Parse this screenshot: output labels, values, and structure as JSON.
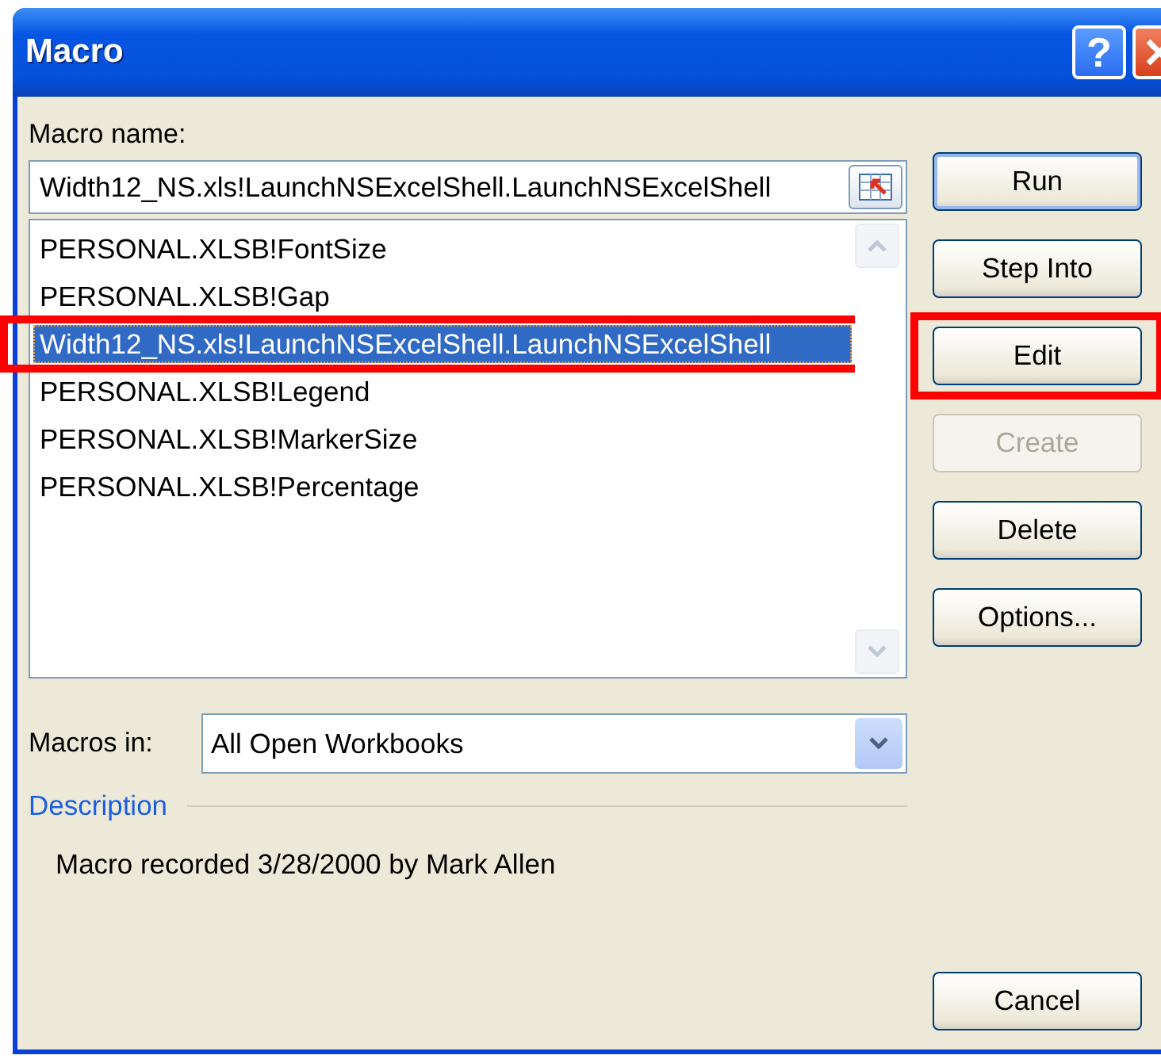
{
  "window": {
    "title": "Macro",
    "help_button": "?"
  },
  "macro_name": {
    "label": "Macro name:",
    "value": "Width12_NS.xls!LaunchNSExcelShell.LaunchNSExcelShell"
  },
  "macro_list": {
    "items": [
      {
        "text": "PERSONAL.XLSB!FontSize",
        "selected": false,
        "highlighted": false
      },
      {
        "text": "PERSONAL.XLSB!Gap",
        "selected": false,
        "highlighted": false
      },
      {
        "text": "Width12_NS.xls!LaunchNSExcelShell.LaunchNSExcelShell",
        "selected": true,
        "highlighted": true
      },
      {
        "text": "PERSONAL.XLSB!Legend",
        "selected": false,
        "highlighted": false
      },
      {
        "text": "PERSONAL.XLSB!MarkerSize",
        "selected": false,
        "highlighted": false
      },
      {
        "text": "PERSONAL.XLSB!Percentage",
        "selected": false,
        "highlighted": false
      }
    ]
  },
  "macros_in": {
    "label": "Macros in:",
    "value": "All Open Workbooks"
  },
  "description": {
    "heading": "Description",
    "text": "Macro recorded 3/28/2000 by Mark Allen"
  },
  "buttons": [
    {
      "label": "Run",
      "default": true,
      "disabled": false,
      "highlighted": false
    },
    {
      "label": "Step Into",
      "default": false,
      "disabled": false,
      "highlighted": false
    },
    {
      "label": "Edit",
      "default": false,
      "disabled": false,
      "highlighted": true
    },
    {
      "label": "Create",
      "default": false,
      "disabled": true,
      "highlighted": false
    },
    {
      "label": "Delete",
      "default": false,
      "disabled": false,
      "highlighted": false
    },
    {
      "label": "Options...",
      "default": false,
      "disabled": false,
      "highlighted": false
    }
  ],
  "cancel_button": {
    "label": "Cancel"
  }
}
